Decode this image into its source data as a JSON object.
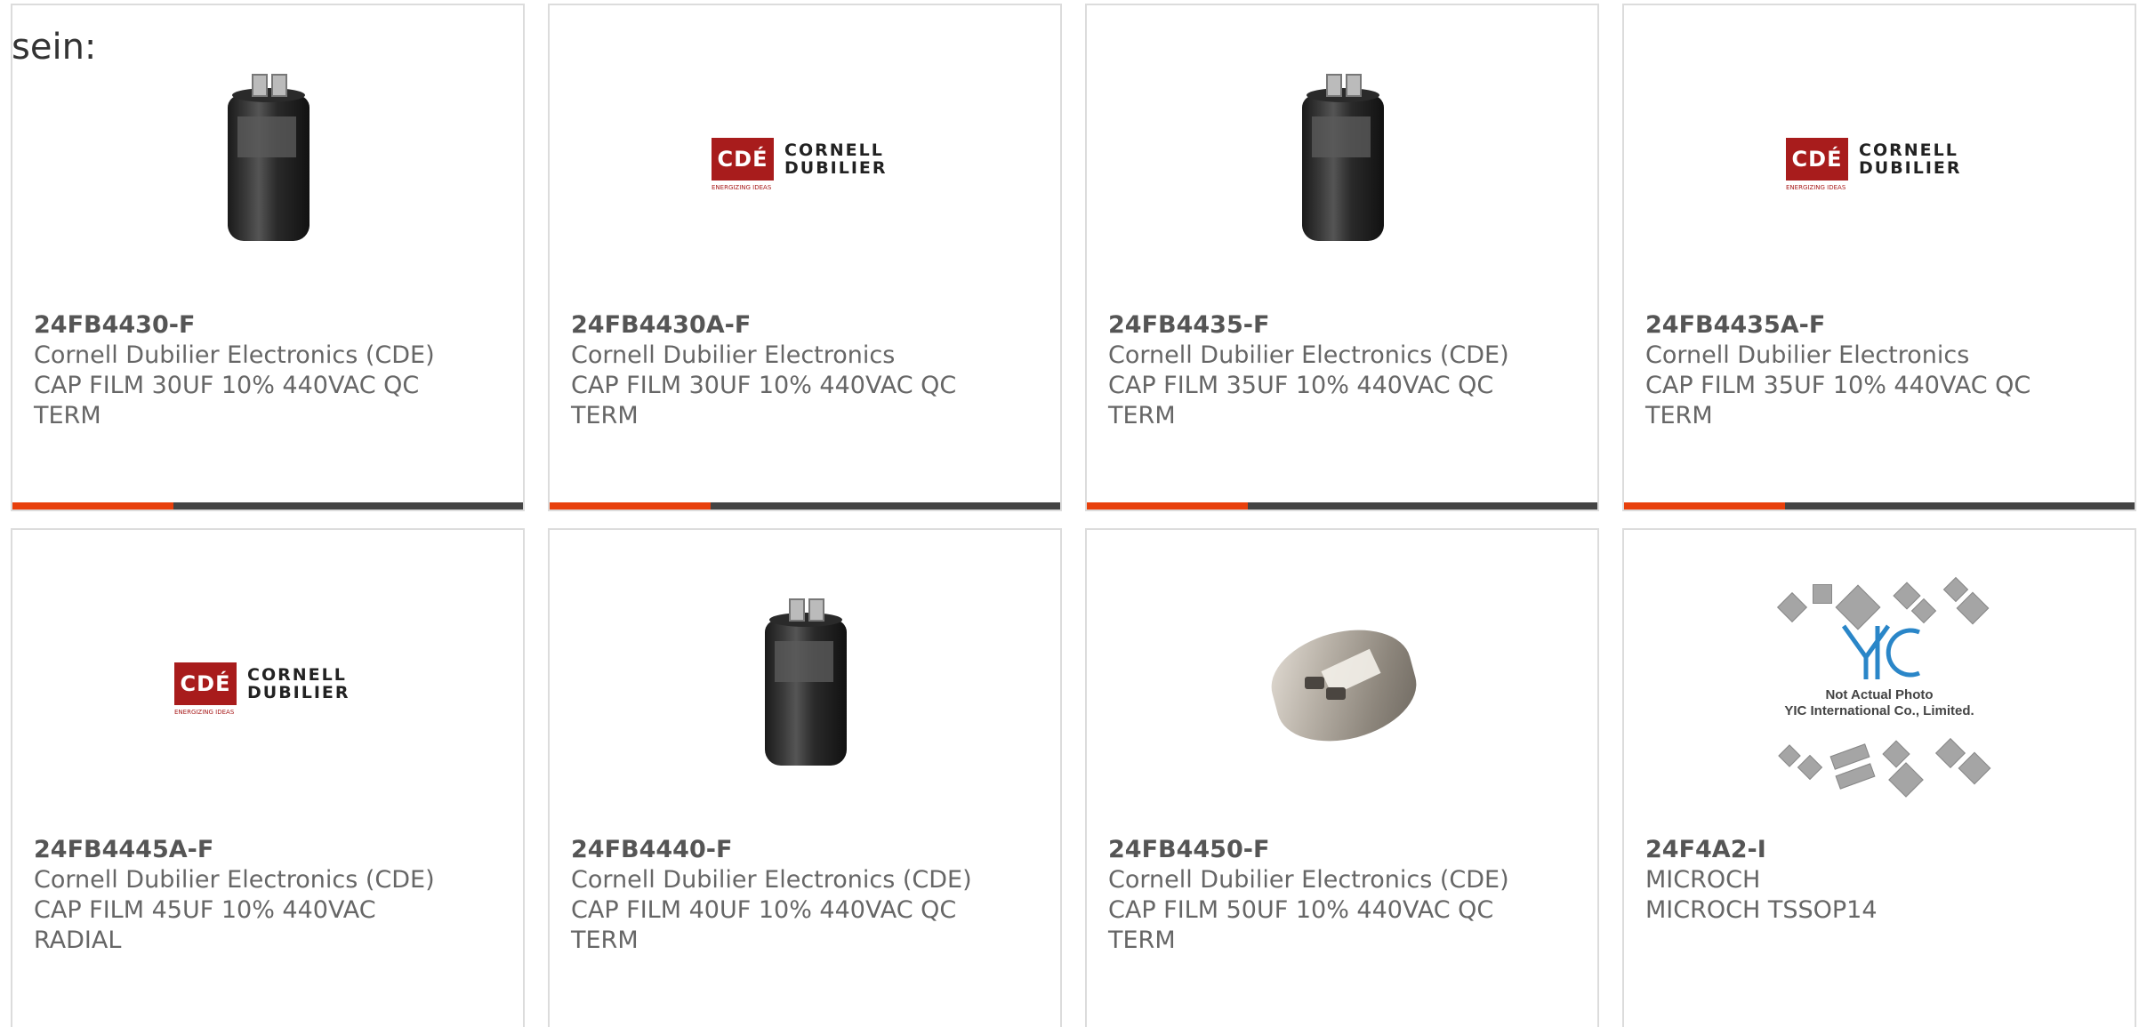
{
  "intro_text": "sein:",
  "accent_color": "#e8400c",
  "bar_color": "#444444",
  "products": [
    {
      "part_number": "24FB4430-F",
      "manufacturer": "Cornell Dubilier Electronics (CDE)",
      "description": "CAP FILM 30UF 10% 440VAC QC TERM",
      "image": "capacitor-black",
      "progress": 0.315
    },
    {
      "part_number": "24FB4430A-F",
      "manufacturer": "Cornell Dubilier Electronics",
      "description": "CAP FILM 30UF 10% 440VAC QC TERM",
      "image": "cde-logo",
      "progress": 0.315
    },
    {
      "part_number": "24FB4435-F",
      "manufacturer": "Cornell Dubilier Electronics (CDE)",
      "description": "CAP FILM 35UF 10% 440VAC QC TERM",
      "image": "capacitor-black",
      "progress": 0.315
    },
    {
      "part_number": "24FB4435A-F",
      "manufacturer": "Cornell Dubilier Electronics",
      "description": "CAP FILM 35UF 10% 440VAC QC TERM",
      "image": "cde-logo",
      "progress": 0.315
    },
    {
      "part_number": "24FB4445A-F",
      "manufacturer": "Cornell Dubilier Electronics (CDE)",
      "description": "CAP FILM 45UF 10% 440VAC RADIAL",
      "image": "cde-logo"
    },
    {
      "part_number": "24FB4440-F",
      "manufacturer": "Cornell Dubilier Electronics (CDE)",
      "description": "CAP FILM 40UF 10% 440VAC QC TERM",
      "image": "capacitor-black"
    },
    {
      "part_number": "24FB4450-F",
      "manufacturer": "Cornell Dubilier Electronics (CDE)",
      "description": "CAP FILM 50UF 10% 440VAC QC TERM",
      "image": "capacitor-silver"
    },
    {
      "part_number": "24F4A2-I",
      "manufacturer": "MICROCH",
      "description": "MICROCH TSSOP14",
      "image": "yic-not-actual-photo"
    }
  ],
  "cde_logo": {
    "mark": "CDÉ",
    "word1": "CORNELL",
    "word2": "DUBILIER",
    "tagline": "ENERGIZING IDEAS"
  },
  "yic_placeholder": {
    "line1": "Not Actual Photo",
    "line2": "YIC International Co., Limited."
  }
}
